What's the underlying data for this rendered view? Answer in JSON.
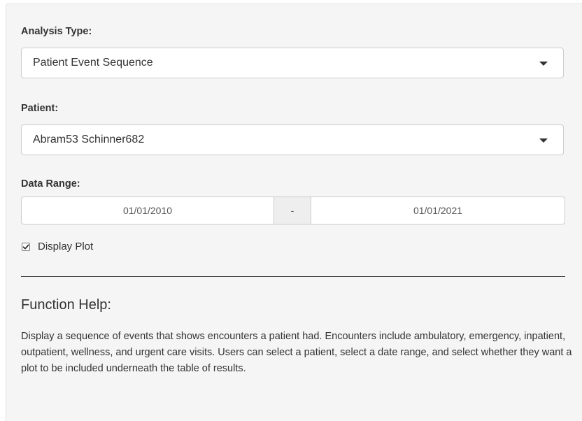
{
  "analysis_type": {
    "label": "Analysis Type:",
    "selected": "Patient Event Sequence"
  },
  "patient": {
    "label": "Patient:",
    "selected": "Abram53 Schinner682"
  },
  "date_range": {
    "label": "Data Range:",
    "start": "01/01/2010",
    "separator": "-",
    "end": "01/01/2021"
  },
  "display_plot": {
    "label": "Display Plot",
    "checked": true
  },
  "help": {
    "title": "Function Help:",
    "text": "Display a sequence of events that shows encounters a patient had. Encounters include ambulatory, emergency, inpatient, outpatient, wellness, and urgent care visits. Users can select a patient, select a date range, and select whether they want a plot to be included underneath the table of results."
  },
  "icons": {
    "dropdown": "caret-down-icon",
    "checkbox": "checkmark-icon"
  }
}
